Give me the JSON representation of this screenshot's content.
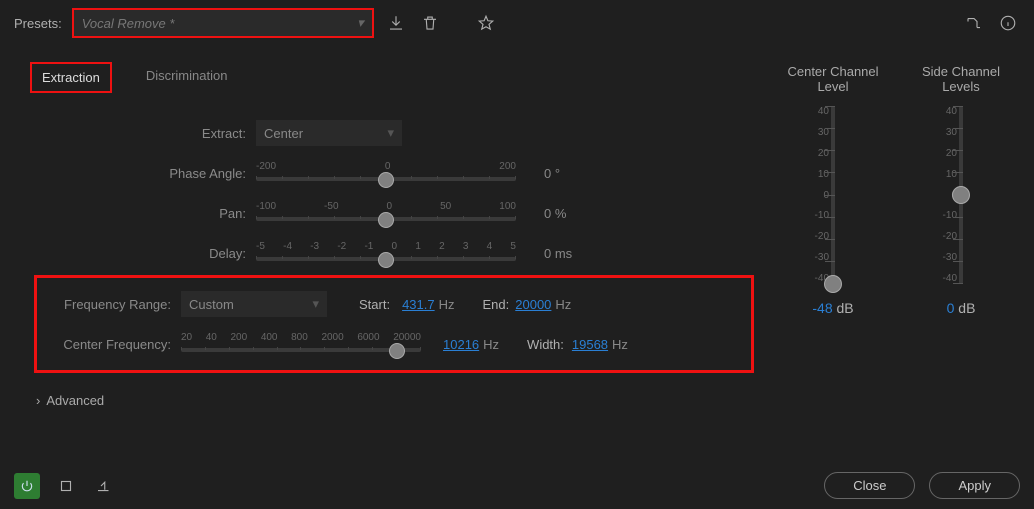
{
  "toolbar": {
    "presets_label": "Presets:",
    "preset_value": "Vocal Remove *"
  },
  "tabs": {
    "extraction": "Extraction",
    "discrimination": "Discrimination"
  },
  "controls": {
    "extract_label": "Extract:",
    "extract_value": "Center",
    "phase_label": "Phase Angle:",
    "phase_ticks": [
      "-200",
      "0",
      "200"
    ],
    "phase_value": "0 °",
    "pan_label": "Pan:",
    "pan_ticks": [
      "-100",
      "-50",
      "0",
      "50",
      "100"
    ],
    "pan_value": "0 %",
    "delay_label": "Delay:",
    "delay_ticks": [
      "-5",
      "-4",
      "-3",
      "-2",
      "-1",
      "0",
      "1",
      "2",
      "3",
      "4",
      "5"
    ],
    "delay_value": "0 ms",
    "freqrange_label": "Frequency Range:",
    "freqrange_value": "Custom",
    "start_label": "Start:",
    "start_value": "431.7",
    "start_unit": "Hz",
    "end_label": "End:",
    "end_value": "20000",
    "end_unit": "Hz",
    "centerfreq_label": "Center Frequency:",
    "cf_ticks": [
      "20",
      "40",
      "200",
      "400",
      "800",
      "2000",
      "6000",
      "20000"
    ],
    "cf_value": "10216",
    "cf_unit": "Hz",
    "width_label": "Width:",
    "width_value": "19568",
    "width_unit": "Hz"
  },
  "sliders": {
    "center": {
      "title": "Center Channel Level",
      "ticks": [
        "40",
        "30",
        "20",
        "10",
        "0",
        "-10",
        "-20",
        "-30",
        "-40"
      ],
      "value": "-48",
      "unit": "dB"
    },
    "side": {
      "title": "Side Channel Levels",
      "ticks": [
        "40",
        "30",
        "20",
        "10",
        "0",
        "-10",
        "-20",
        "-30",
        "-40"
      ],
      "value": "0",
      "unit": "dB"
    }
  },
  "advanced": "Advanced",
  "footer": {
    "close": "Close",
    "apply": "Apply"
  }
}
